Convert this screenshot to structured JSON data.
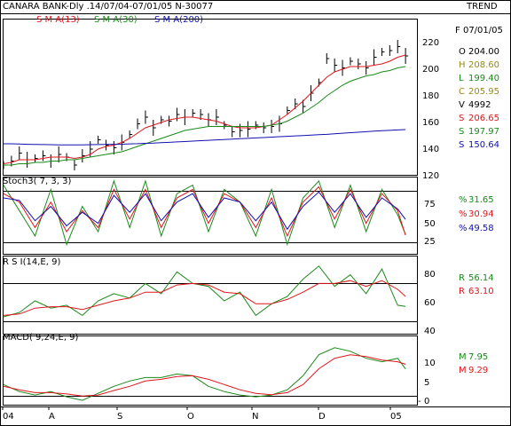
{
  "header": {
    "title": "CANARA BANK-Dly .14/07/04-07/01/05  N-30077",
    "trend": "TREND"
  },
  "price_panel": {
    "legend": [
      {
        "label": "S M A(13)",
        "color": "#e0151a"
      },
      {
        "label": "S M A(30)",
        "color": "#1a8a1a"
      },
      {
        "label": "S M A(200)",
        "color": "#1010b0"
      }
    ],
    "y_ticks": [
      "220",
      "200",
      "180",
      "160",
      "140",
      "120"
    ],
    "info": [
      {
        "key": "F",
        "value": "07/01/05",
        "color": "#000000"
      },
      {
        "key": "O",
        "value": "204.00",
        "color": "#000000"
      },
      {
        "key": "H",
        "value": "208.60",
        "color": "#9a8a1a"
      },
      {
        "key": "L",
        "value": "199.40",
        "color": "#1a8a1a"
      },
      {
        "key": "C",
        "value": "205.95",
        "color": "#9a8a1a"
      },
      {
        "key": "V",
        "value": "4992",
        "color": "#000000"
      },
      {
        "key": "S",
        "value": "206.65",
        "color": "#e0151a"
      },
      {
        "key": "S",
        "value": "197.97",
        "color": "#1a8a1a"
      },
      {
        "key": "S",
        "value": "150.64",
        "color": "#1010b0"
      }
    ]
  },
  "stoch_panel": {
    "title": "Stoch3( 7, 3, 3)",
    "y_ticks": [
      "75",
      "50",
      "25"
    ],
    "info": [
      {
        "key": "%",
        "value": "31.65",
        "color": "#1a8a1a"
      },
      {
        "key": "%",
        "value": "30.94",
        "color": "#e0151a"
      },
      {
        "key": "%",
        "value": "49.58",
        "color": "#1010b0"
      }
    ]
  },
  "rsi_panel": {
    "title": "R S I(14,E, 9)",
    "y_ticks": [
      "80",
      "60",
      "40"
    ],
    "info": [
      {
        "key": "R",
        "value": "56.14",
        "color": "#1a8a1a"
      },
      {
        "key": "R",
        "value": "63.10",
        "color": "#e0151a"
      }
    ]
  },
  "macd_panel": {
    "title": "MACD( 9,24,E, 9)",
    "y_ticks": [
      "10",
      "5",
      "0"
    ],
    "info": [
      {
        "key": "M",
        "value": "7.95",
        "color": "#1a8a1a"
      },
      {
        "key": "M",
        "value": "9.29",
        "color": "#e0151a"
      }
    ]
  },
  "x_axis": {
    "labels": [
      "04",
      "A",
      "S",
      "O",
      "N",
      "D",
      "05"
    ]
  },
  "chart_data": [
    {
      "type": "line",
      "panel": "price",
      "title": "CANARA BANK-Dly .14/07/04-07/01/05  N-30077",
      "x": [
        0,
        10,
        20,
        30,
        40,
        50,
        60,
        70,
        80,
        90,
        100,
        110,
        120,
        130,
        140,
        150,
        160,
        170,
        180,
        190,
        200,
        210,
        220,
        230,
        240,
        250,
        260,
        270,
        280,
        290,
        300,
        310,
        320,
        330,
        340,
        350,
        360,
        370,
        380,
        390,
        400,
        410,
        420,
        430,
        440,
        450,
        460,
        470,
        480,
        490,
        500,
        510
      ],
      "xlim": [
        0,
        520
      ],
      "ylim": [
        118,
        232
      ],
      "series": [
        {
          "name": "Price",
          "color": "#000000",
          "values": [
            124,
            127,
            133,
            128,
            129,
            131,
            127,
            132,
            130,
            124,
            131,
            136,
            143,
            139,
            137,
            141,
            147,
            155,
            160,
            152,
            158,
            157,
            162,
            160,
            163,
            162,
            158,
            160,
            154,
            149,
            150,
            151,
            154,
            152,
            153,
            155,
            165,
            170,
            168,
            178,
            186,
            204,
            199,
            197,
            202,
            200,
            197,
            205,
            209,
            210,
            213,
            206
          ]
        },
        {
          "name": "S M A(13)",
          "color": "#e0151a",
          "values": [
            125,
            126,
            128,
            128,
            128,
            129,
            130,
            130,
            130,
            129,
            130,
            132,
            136,
            138,
            139,
            141,
            144,
            148,
            152,
            154,
            156,
            158,
            159,
            160,
            160,
            159,
            158,
            157,
            155,
            153,
            152,
            152,
            152,
            153,
            154,
            158,
            162,
            167,
            172,
            178,
            184,
            190,
            194,
            196,
            198,
            198,
            198,
            199,
            200,
            202,
            205,
            206.65
          ]
        },
        {
          "name": "S M A(30)",
          "color": "#1a8a1a",
          "values": [
            124,
            124,
            125,
            125,
            126,
            126,
            127,
            127,
            128,
            128,
            129,
            130,
            131,
            132,
            133,
            134,
            136,
            138,
            140,
            142,
            144,
            146,
            148,
            150,
            151,
            152,
            153,
            153,
            153,
            153,
            153,
            153,
            153,
            153,
            154,
            155,
            157,
            160,
            163,
            167,
            171,
            176,
            180,
            184,
            187,
            189,
            191,
            192,
            194,
            195,
            197,
            197.97
          ]
        },
        {
          "name": "S M A(200)",
          "color": "#1010b0",
          "values": [
            140,
            140,
            139.8,
            139.6,
            139.5,
            139.4,
            139.3,
            139.2,
            139.2,
            139.2,
            139.2,
            139.3,
            139.4,
            139.5,
            139.6,
            139.7,
            139.9,
            140.1,
            140.3,
            140.5,
            140.8,
            141.1,
            141.4,
            141.7,
            142,
            142.3,
            142.6,
            142.9,
            143.2,
            143.5,
            143.8,
            144.1,
            144.4,
            144.7,
            145,
            145.3,
            145.6,
            145.9,
            146.2,
            146.5,
            146.8,
            147.1,
            147.5,
            147.9,
            148.3,
            148.7,
            149.1,
            149.5,
            149.8,
            150.1,
            150.4,
            150.64
          ]
        }
      ]
    },
    {
      "type": "line",
      "panel": "stochastic",
      "title": "Stoch3( 7, 3, 3)",
      "x": [
        0,
        20,
        40,
        60,
        80,
        100,
        120,
        140,
        160,
        180,
        200,
        220,
        240,
        260,
        280,
        300,
        320,
        340,
        360,
        380,
        400,
        420,
        440,
        460,
        480,
        500,
        510
      ],
      "xlim": [
        0,
        520
      ],
      "ylim": [
        10,
        98
      ],
      "series": [
        {
          "name": "%K",
          "color": "#1a8a1a",
          "values": [
            90,
            60,
            30,
            85,
            20,
            65,
            35,
            95,
            40,
            95,
            30,
            80,
            90,
            35,
            85,
            70,
            30,
            85,
            20,
            75,
            95,
            40,
            90,
            35,
            85,
            55,
            31.65
          ]
        },
        {
          "name": "%D",
          "color": "#e0151a",
          "values": [
            80,
            70,
            40,
            70,
            35,
            60,
            40,
            85,
            50,
            85,
            40,
            75,
            85,
            45,
            80,
            70,
            40,
            75,
            30,
            70,
            88,
            50,
            85,
            45,
            80,
            60,
            30.94
          ]
        },
        {
          "name": "%S",
          "color": "#1010b0",
          "values": [
            75,
            72,
            48,
            65,
            42,
            58,
            45,
            78,
            58,
            80,
            48,
            70,
            80,
            52,
            75,
            70,
            48,
            70,
            38,
            65,
            82,
            58,
            80,
            52,
            75,
            62,
            49.58
          ]
        }
      ]
    },
    {
      "type": "line",
      "panel": "rsi",
      "title": "R S I(14,E, 9)",
      "x": [
        0,
        20,
        40,
        60,
        80,
        100,
        120,
        140,
        160,
        180,
        200,
        220,
        240,
        260,
        280,
        300,
        320,
        340,
        360,
        380,
        400,
        420,
        440,
        460,
        480,
        500,
        510
      ],
      "xlim": [
        0,
        520
      ],
      "ylim": [
        38,
        90
      ],
      "series": [
        {
          "name": "RSI",
          "color": "#1a8a1a",
          "values": [
            49,
            52,
            60,
            55,
            57,
            50,
            60,
            65,
            62,
            72,
            65,
            80,
            72,
            70,
            60,
            66,
            50,
            58,
            63,
            75,
            84,
            70,
            78,
            65,
            82,
            57,
            56.14
          ]
        },
        {
          "name": "Signal",
          "color": "#e0151a",
          "values": [
            50,
            51,
            55,
            56,
            56,
            54,
            57,
            60,
            62,
            66,
            66,
            71,
            72,
            71,
            66,
            65,
            58,
            58,
            61,
            66,
            72,
            72,
            74,
            70,
            74,
            68,
            63.1
          ]
        }
      ]
    },
    {
      "type": "line",
      "panel": "macd",
      "title": "MACD( 9,24,E, 9)",
      "x": [
        0,
        20,
        40,
        60,
        80,
        100,
        120,
        140,
        160,
        180,
        200,
        220,
        240,
        260,
        280,
        300,
        320,
        340,
        360,
        380,
        400,
        420,
        440,
        460,
        480,
        500,
        510
      ],
      "xlim": [
        0,
        520
      ],
      "ylim": [
        -2,
        17
      ],
      "series": [
        {
          "name": "MACD",
          "color": "#1a8a1a",
          "values": [
            3.5,
            1.5,
            0.5,
            1.5,
            0,
            -1,
            1,
            3,
            4.5,
            5.5,
            5.5,
            6.5,
            6,
            3,
            1.5,
            0.5,
            0,
            0.5,
            2,
            6,
            12,
            14,
            13,
            11,
            10,
            11,
            7.95
          ]
        },
        {
          "name": "Signal",
          "color": "#e0151a",
          "values": [
            3,
            2,
            1.2,
            1.2,
            0.8,
            0.2,
            0.5,
            1.8,
            3,
            4.5,
            5,
            5.8,
            6,
            5,
            3.5,
            2,
            1,
            0.6,
            1.2,
            3.5,
            8,
            11,
            12,
            11.5,
            10.5,
            10,
            9.29
          ]
        }
      ]
    }
  ]
}
